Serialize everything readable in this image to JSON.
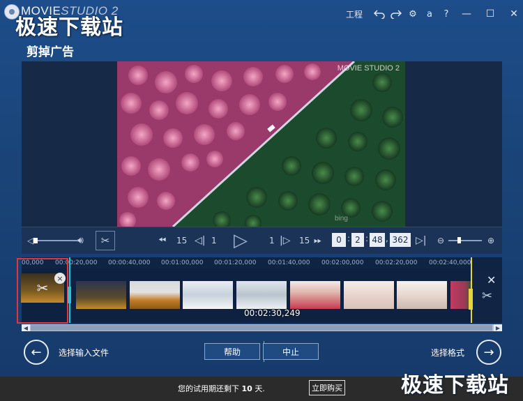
{
  "app": {
    "logo_main": "MOVIE",
    "logo_studio": "STUDIO 2",
    "watermark": "极速下载站"
  },
  "titlebar": {
    "project_label": "工程",
    "undo_icon": "undo-icon",
    "redo_icon": "redo-icon",
    "settings_icon": "gear-icon",
    "account_label": "a",
    "help_label": "?"
  },
  "section": {
    "title": "剪掉广告"
  },
  "preview": {
    "video_watermark": "MOVIE STUDIO 2",
    "bing_watermark": "bing"
  },
  "controls": {
    "step_back_seconds": "15",
    "step_back_frames": "1",
    "step_fwd_frames": "1",
    "step_fwd_seconds": "15",
    "time": {
      "h": "0",
      "m": "2",
      "s": "48",
      "ms": "362"
    },
    "sep_colon": ":",
    "sep_comma": ","
  },
  "timeline": {
    "ruler": [
      "00,000",
      "00:00:20,000",
      "00:00:40,000",
      "00:01:00,000",
      "00:01:20,000",
      "00:01:40,000",
      "00:02:00,000",
      "00:02:20,000",
      "00:02:40,000"
    ],
    "current_time": "00:02:30,249",
    "close_symbol": "×"
  },
  "nav": {
    "prev_label": "选择输入文件",
    "next_label": "选择格式",
    "help_button": "帮助",
    "stop_button": "中止"
  },
  "trial": {
    "text_before": "您的试用期还剩下",
    "days": "10",
    "text_after": "天.",
    "buy_button": "立即购买"
  },
  "colors": {
    "accent": "#1d4d8a",
    "cut_border": "#e0363c",
    "start_marker": "#29c4d6",
    "end_marker": "#e6d43a"
  }
}
